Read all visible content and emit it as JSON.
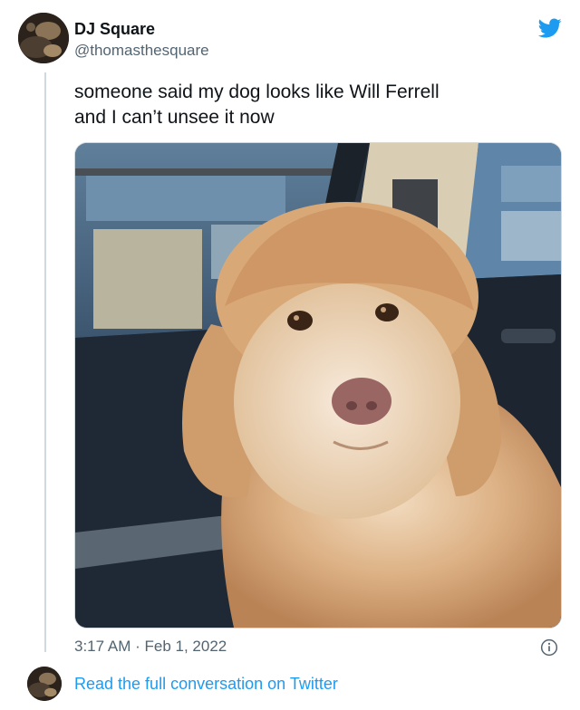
{
  "tweet": {
    "author_name": "DJ Square",
    "author_handle": "@thomasthesquare",
    "text_lines": [
      "someone said my dog looks like Will Ferrell",
      "and I can’t unsee it now"
    ],
    "time": "3:17 AM",
    "separator": "·",
    "date": "Feb 1, 2022",
    "photo_subject": "dog-photo"
  },
  "footer": {
    "link_text": "Read the full conversation on Twitter"
  },
  "icons": {
    "brand": "twitter-bird-icon",
    "info": "info-icon"
  },
  "colors": {
    "brand_blue": "#1d9bf0",
    "secondary_text": "#536471",
    "thread_line": "#cfd9de"
  }
}
